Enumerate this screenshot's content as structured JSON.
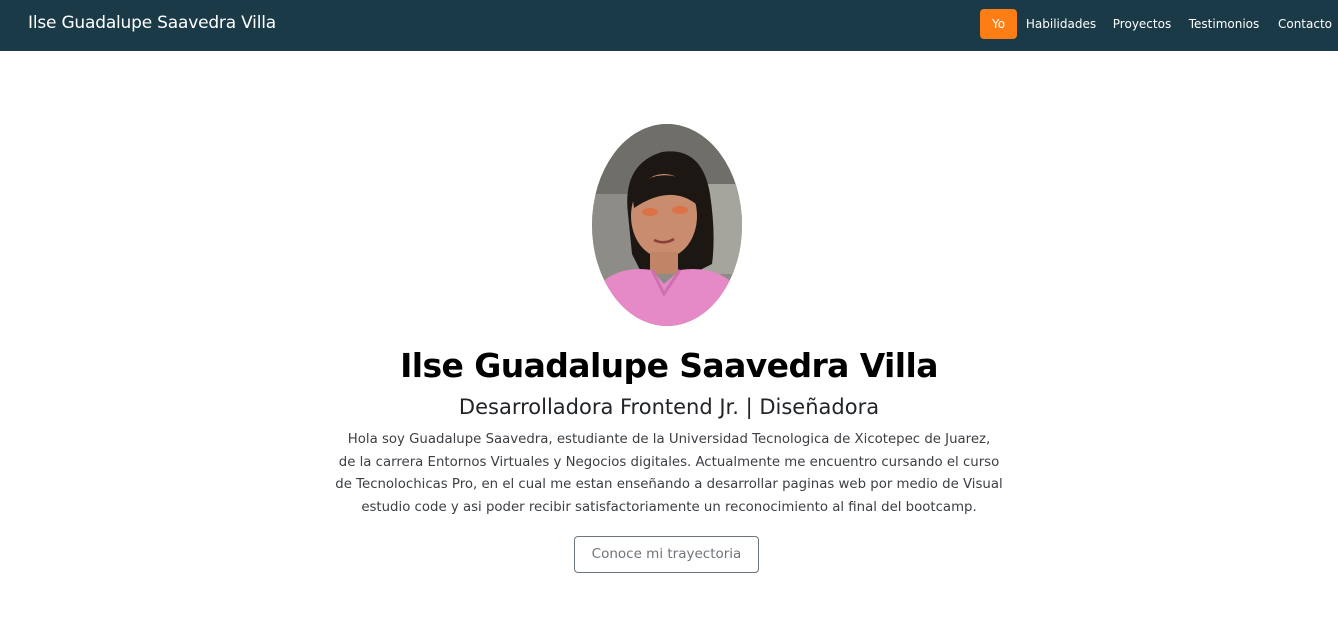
{
  "navbar": {
    "brand": "Ilse Guadalupe Saavedra Villa",
    "links": [
      {
        "label": "Yo",
        "active": true
      },
      {
        "label": "Habilidades",
        "active": false
      },
      {
        "label": "Proyectos",
        "active": false
      },
      {
        "label": "Testimonios",
        "active": false
      },
      {
        "label": "Contacto",
        "active": false
      }
    ]
  },
  "hero": {
    "name": "Ilse Guadalupe Saavedra Villa",
    "role": "Desarrolladora Frontend Jr. | Diseñadora",
    "bio_lines": [
      "Hola soy Guadalupe Saavedra, estudiante de la Universidad Tecnologica de Xicotepec de Juarez,",
      "de la carrera Entornos Virtuales y Negocios digitales. Actualmente me encuentro cursando el curso",
      "de Tecnolochicas Pro, en el cual me estan enseñando a desarrollar paginas web por medio de Visual",
      "estudio code y asi poder recibir satisfactoriamente un reconocimiento al final del bootcamp."
    ],
    "cta_label": "Conoce mi trayectoria"
  },
  "colors": {
    "navbar_bg": "#1a3a47",
    "active_link_bg": "#fd7e14",
    "cta_border": "#6c757d"
  }
}
